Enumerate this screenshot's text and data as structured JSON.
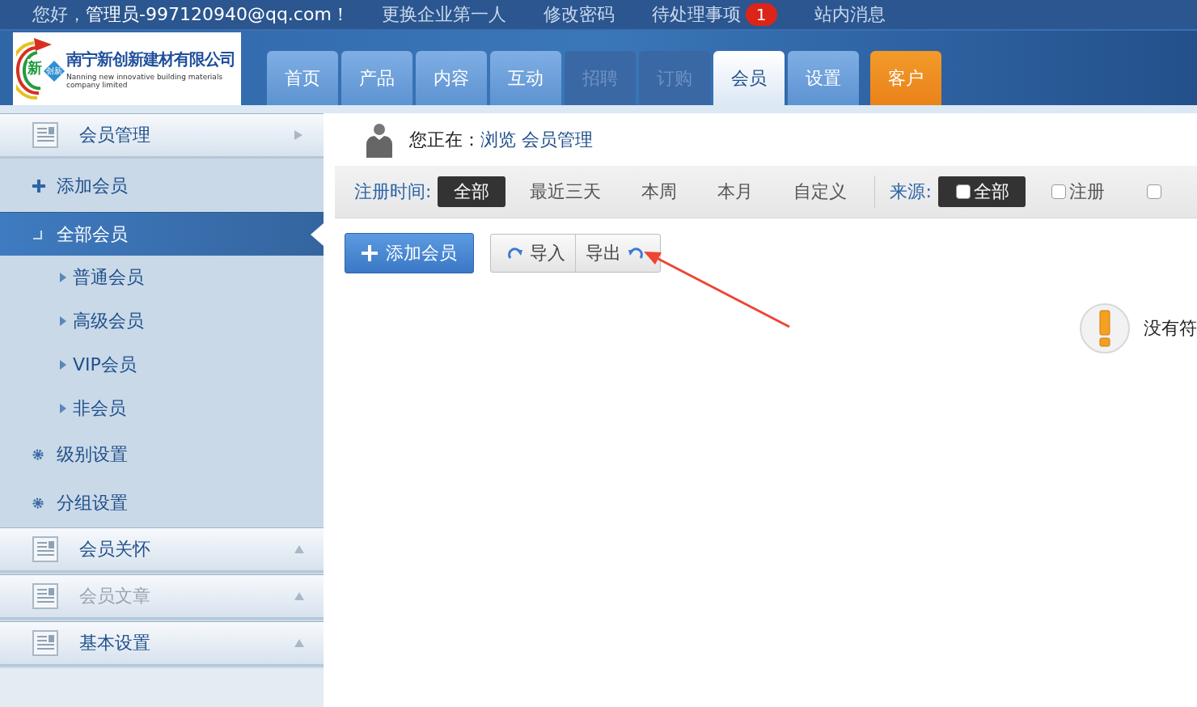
{
  "topbar": {
    "greeting": "您好，",
    "user": "管理员-997120940@qq.com！",
    "links": [
      {
        "label": "更换企业第一人"
      },
      {
        "label": "修改密码"
      },
      {
        "label": "待处理事项",
        "badge": "1"
      },
      {
        "label": "站内消息"
      }
    ]
  },
  "logo": {
    "mark": "新",
    "mark_small": "创新",
    "name": "南宁新创新建材有限公司",
    "subtitle": "Nanning new innovative building materials company limited"
  },
  "nav_tabs": [
    {
      "label": "首页",
      "kind": "normal",
      "selected": false,
      "disabled": false
    },
    {
      "label": "产品",
      "kind": "normal",
      "selected": false,
      "disabled": false
    },
    {
      "label": "内容",
      "kind": "normal",
      "selected": false,
      "disabled": false
    },
    {
      "label": "互动",
      "kind": "normal",
      "selected": false,
      "disabled": false
    },
    {
      "label": "招聘",
      "kind": "normal",
      "selected": false,
      "disabled": true
    },
    {
      "label": "订购",
      "kind": "normal",
      "selected": false,
      "disabled": true
    },
    {
      "label": "会员",
      "kind": "normal",
      "selected": true,
      "disabled": false
    },
    {
      "label": "设置",
      "kind": "normal",
      "selected": false,
      "disabled": false
    },
    {
      "label": "客户",
      "kind": "accent",
      "selected": false,
      "disabled": false
    }
  ],
  "sidebar": {
    "sections": [
      {
        "title": "会员管理",
        "expanded": true,
        "disabled": false,
        "items": [
          {
            "label": "添加会员",
            "kind": "add",
            "selected": false
          },
          {
            "label": "全部会员",
            "kind": "folder",
            "selected": true,
            "expanded": true,
            "children": [
              {
                "label": "普通会员",
                "selected": false
              },
              {
                "label": "高级会员",
                "selected": false
              },
              {
                "label": "VIP会员",
                "selected": false
              },
              {
                "label": "非会员",
                "selected": false
              }
            ]
          },
          {
            "label": "级别设置",
            "kind": "setting",
            "selected": false
          },
          {
            "label": "分组设置",
            "kind": "setting",
            "selected": false
          }
        ]
      },
      {
        "title": "会员关怀",
        "expanded": false,
        "disabled": false
      },
      {
        "title": "会员文章",
        "expanded": false,
        "disabled": true
      },
      {
        "title": "基本设置",
        "expanded": false,
        "disabled": false
      }
    ]
  },
  "breadcrumb": {
    "prefix": "您正在：",
    "path": "浏览 会员管理"
  },
  "filters": {
    "time_label": "注册时间:",
    "time_options": [
      {
        "label": "全部",
        "selected": true
      },
      {
        "label": "最近三天",
        "selected": false
      },
      {
        "label": "本周",
        "selected": false
      },
      {
        "label": "本月",
        "selected": false
      },
      {
        "label": "自定义",
        "selected": false
      }
    ],
    "source_label": "来源:",
    "source_options": [
      {
        "label": "全部",
        "selected": true
      },
      {
        "label": "注册",
        "selected": false
      },
      {
        "selected": false
      }
    ]
  },
  "actions": {
    "add_button": "添加会员",
    "import_button": "导入",
    "export_button": "导出"
  },
  "notice": {
    "text": "没有符"
  }
}
